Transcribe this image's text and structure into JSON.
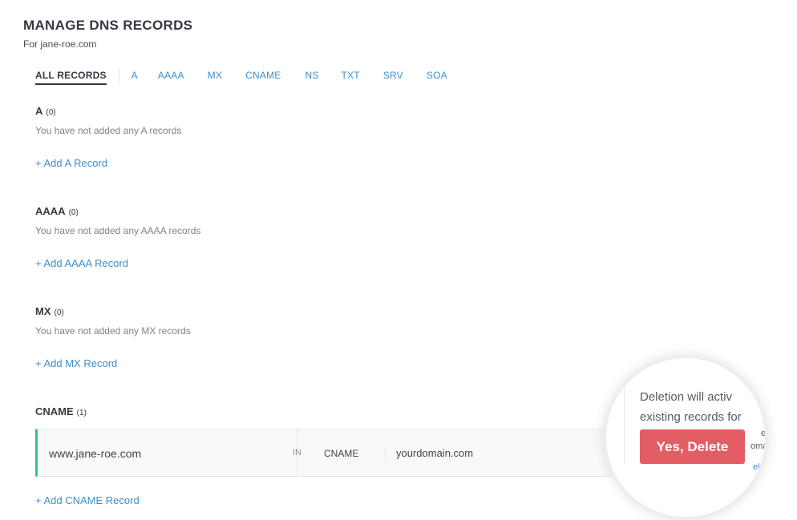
{
  "header": {
    "title": "MANAGE DNS RECORDS",
    "subtitle": "For jane-roe.com"
  },
  "tabs": [
    {
      "label": "ALL RECORDS",
      "active": true
    },
    {
      "label": "A"
    },
    {
      "label": "AAAA"
    },
    {
      "label": "MX"
    },
    {
      "label": "CNAME"
    },
    {
      "label": "NS"
    },
    {
      "label": "TXT"
    },
    {
      "label": "SRV"
    },
    {
      "label": "SOA"
    }
  ],
  "sections": {
    "a": {
      "title": "A",
      "count": "(0)",
      "empty": "You have not added any A records",
      "add": "+ Add A Record"
    },
    "aaaa": {
      "title": "AAAA",
      "count": "(0)",
      "empty": "You have not added any AAAA records",
      "add": "+ Add AAAA Record"
    },
    "mx": {
      "title": "MX",
      "count": "(0)",
      "empty": "You have not added any MX records",
      "add": "+ Add MX Record"
    },
    "cname": {
      "title": "CNAME",
      "count": "(1)",
      "add": "+ Add CNAME Record"
    }
  },
  "cname_record": {
    "hostname": "www.jane-roe.com",
    "class": "IN",
    "type": "CNAME",
    "value": "yourdomain.com"
  },
  "delete_popover": {
    "line1": "Deletion will activ",
    "line2": "existing records for",
    "confirm_label": "Yes, Delete",
    "edge_fragment_1": "e",
    "edge_fragment_2": "omain.",
    "edge_link_fragment": "el"
  },
  "colors": {
    "accent_link": "#3d8fcc",
    "heading": "#333a44",
    "record_highlight": "#3bbf95",
    "danger": "#e35d64"
  }
}
